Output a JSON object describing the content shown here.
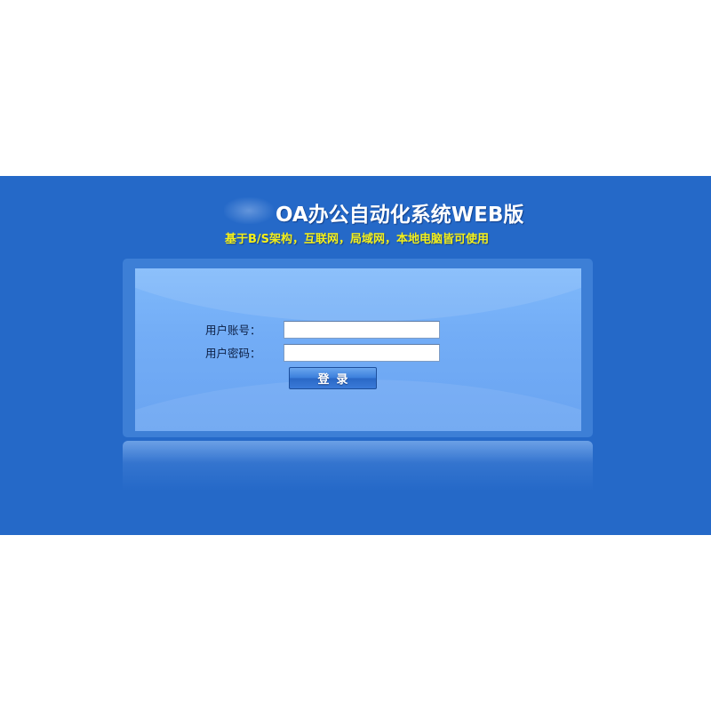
{
  "header": {
    "title": "OA办公自动化系统WEB版",
    "subtitle": "基于B/S架构，互联网，局域网，本地电脑皆可使用"
  },
  "login_form": {
    "username_label": "用户账号：",
    "username_value": "",
    "password_label": "用户密码：",
    "password_value": "",
    "submit_label": "登录"
  },
  "colors": {
    "background_band": "#2569c8",
    "panel": "#7fb9fb",
    "subtitle_text": "#f4f01a",
    "title_text": "#ffffff"
  }
}
